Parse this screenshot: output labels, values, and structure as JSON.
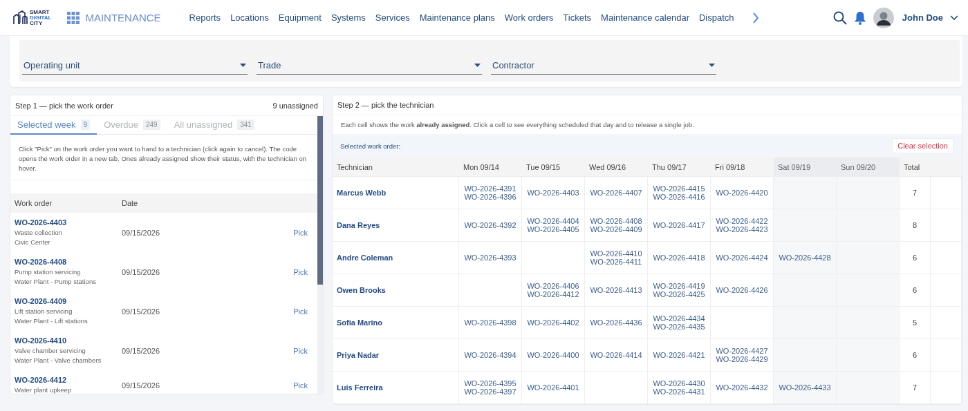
{
  "header": {
    "logo_lines": [
      "SMART",
      "DIGITAL",
      "CITY"
    ],
    "app_title": "MAINTENANCE",
    "nav": [
      {
        "label": "Reports",
        "selected": false
      },
      {
        "label": "Locations",
        "selected": false
      },
      {
        "label": "Equipment",
        "selected": false
      },
      {
        "label": "Systems",
        "selected": false
      },
      {
        "label": "Services",
        "selected": false
      },
      {
        "label": "Maintenance plans",
        "selected": false
      },
      {
        "label": "Work orders",
        "selected": false
      },
      {
        "label": "Tickets",
        "selected": false
      },
      {
        "label": "Maintenance calendar",
        "selected": false
      },
      {
        "label": "Dispatch",
        "selected": false
      }
    ],
    "user_name": "John Doe"
  },
  "filters": [
    {
      "label": "Operating unit"
    },
    {
      "label": "Trade"
    },
    {
      "label": "Contractor"
    }
  ],
  "step1": {
    "title": "Step 1 — pick the work order",
    "count": "9 unassigned",
    "tabs": [
      {
        "label": "Selected week",
        "count": "9",
        "selected": true
      },
      {
        "label": "Overdue",
        "count": "249",
        "selected": false
      },
      {
        "label": "All unassigned",
        "count": "341",
        "selected": false
      }
    ],
    "description": "Click \"Pick\" on the work order you want to hand to a technician (click again to cancel). The code opens the work order in a new tab. Ones already assigned show their status, with the technician on hover.",
    "columns": [
      "Work order",
      "Date"
    ],
    "rows": [
      {
        "id": "WO-2026-4403",
        "lines": [
          "Waste collection",
          "Civic Center"
        ],
        "date": "09/15/2026",
        "action": "Pick"
      },
      {
        "id": "WO-2026-4408",
        "lines": [
          "Pump station servicing",
          "Water Plant - Pump stations"
        ],
        "date": "09/15/2026",
        "action": "Pick"
      },
      {
        "id": "WO-2026-4409",
        "lines": [
          "Lift station servicing",
          "Water Plant - Lift stations"
        ],
        "date": "09/15/2026",
        "action": "Pick"
      },
      {
        "id": "WO-2026-4410",
        "lines": [
          "Valve chamber servicing",
          "Water Plant - Valve chambers"
        ],
        "date": "09/15/2026",
        "action": "Pick"
      },
      {
        "id": "WO-2026-4412",
        "lines": [
          "Water plant upkeep"
        ],
        "date": "09/15/2026",
        "action": "Pick"
      }
    ]
  },
  "step2": {
    "title": "Step 2 — pick the technician",
    "description": "Each cell shows the work **already assigned**. Click a cell to see everything scheduled that day and to release a single job.",
    "selected_label": "Selected work order:",
    "clear_button": "Clear selection",
    "technician_header": "Technician",
    "total_header": "Total",
    "columns": [
      {
        "label": "Mon 09/14",
        "weekend": false
      },
      {
        "label": "Tue 09/15",
        "weekend": false
      },
      {
        "label": "Wed 09/16",
        "weekend": false
      },
      {
        "label": "Thu 09/17",
        "weekend": false
      },
      {
        "label": "Fri 09/18",
        "weekend": false
      },
      {
        "label": "Sat 09/19",
        "weekend": true
      },
      {
        "label": "Sun 09/20",
        "weekend": true
      }
    ],
    "rows": [
      {
        "technician": "Marcus Webb",
        "cells": [
          [
            "WO-2026-4391",
            "WO-2026-4396"
          ],
          [
            "WO-2026-4403"
          ],
          [
            "WO-2026-4407"
          ],
          [
            "WO-2026-4415",
            "WO-2026-4416"
          ],
          [
            "WO-2026-4420"
          ],
          [],
          []
        ],
        "total": "7"
      },
      {
        "technician": "Dana Reyes",
        "cells": [
          [
            "WO-2026-4392"
          ],
          [
            "WO-2026-4404",
            "WO-2026-4405"
          ],
          [
            "WO-2026-4408",
            "WO-2026-4409"
          ],
          [
            "WO-2026-4417"
          ],
          [
            "WO-2026-4422",
            "WO-2026-4423"
          ],
          [],
          []
        ],
        "total": "8"
      },
      {
        "technician": "Andre Coleman",
        "cells": [
          [
            "WO-2026-4393"
          ],
          [],
          [
            "WO-2026-4410",
            "WO-2026-4411"
          ],
          [
            "WO-2026-4418"
          ],
          [
            "WO-2026-4424"
          ],
          [
            "WO-2026-4428"
          ],
          []
        ],
        "total": "6"
      },
      {
        "technician": "Owen Brooks",
        "cells": [
          [],
          [
            "WO-2026-4406",
            "WO-2026-4412"
          ],
          [
            "WO-2026-4413"
          ],
          [
            "WO-2026-4419",
            "WO-2026-4425"
          ],
          [
            "WO-2026-4426"
          ],
          [],
          []
        ],
        "total": "6"
      },
      {
        "technician": "Sofia Marino",
        "cells": [
          [
            "WO-2026-4398"
          ],
          [
            "WO-2026-4402"
          ],
          [
            "WO-2026-4436"
          ],
          [
            "WO-2026-4434",
            "WO-2026-4435"
          ],
          [],
          [],
          []
        ],
        "total": "5"
      },
      {
        "technician": "Priya Nadar",
        "cells": [
          [
            "WO-2026-4394"
          ],
          [
            "WO-2026-4400"
          ],
          [
            "WO-2026-4414"
          ],
          [
            "WO-2026-4421"
          ],
          [
            "WO-2026-4427",
            "WO-2026-4429"
          ],
          [],
          []
        ],
        "total": "6"
      },
      {
        "technician": "Luis Ferreira",
        "cells": [
          [
            "WO-2026-4395",
            "WO-2026-4397"
          ],
          [
            "WO-2026-4401"
          ],
          [],
          [
            "WO-2026-4430",
            "WO-2026-4431"
          ],
          [
            "WO-2026-4432"
          ],
          [
            "WO-2026-4433"
          ],
          []
        ],
        "total": "7"
      }
    ]
  }
}
